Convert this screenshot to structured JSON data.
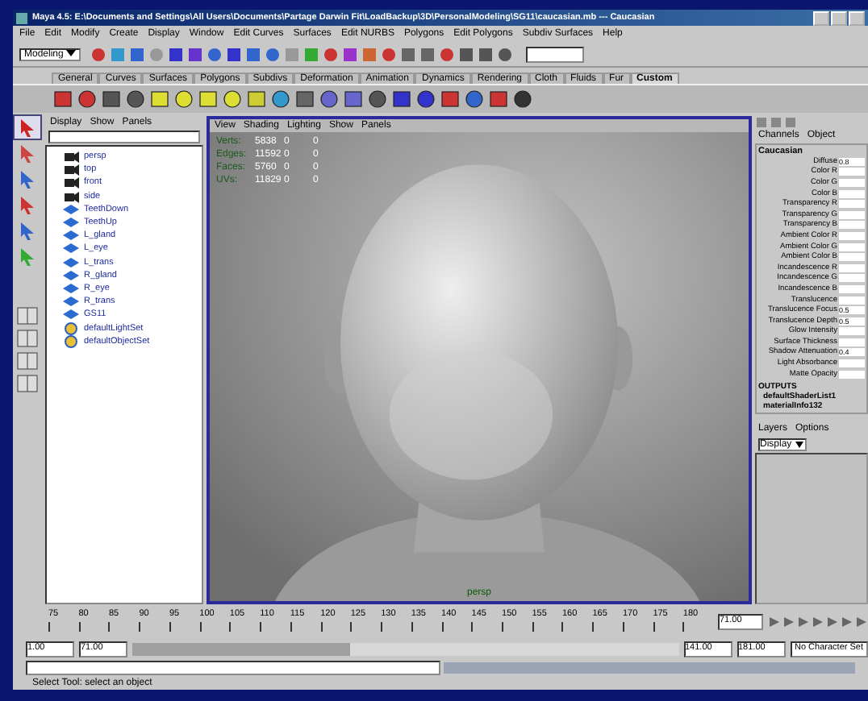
{
  "window": {
    "title": "Maya 4.5: E:\\Documents and Settings\\All Users\\Documents\\Partage Darwin Fit\\LoadBackup\\3D\\PersonalModeling\\SG11\\caucasian.mb  ---  Caucasian"
  },
  "menu": [
    "File",
    "Edit",
    "Modify",
    "Create",
    "Display",
    "Window",
    "Edit Curves",
    "Surfaces",
    "Edit NURBS",
    "Polygons",
    "Edit Polygons",
    "Subdiv Surfaces",
    "Help"
  ],
  "toolbar": {
    "mode": "Modeling"
  },
  "shelf_tabs": [
    {
      "label": "General",
      "selected": false
    },
    {
      "label": "Curves",
      "selected": false
    },
    {
      "label": "Surfaces",
      "selected": false
    },
    {
      "label": "Polygons",
      "selected": false
    },
    {
      "label": "Subdivs",
      "selected": false
    },
    {
      "label": "Deformation",
      "selected": false
    },
    {
      "label": "Animation",
      "selected": false
    },
    {
      "label": "Dynamics",
      "selected": false
    },
    {
      "label": "Rendering",
      "selected": false
    },
    {
      "label": "Cloth",
      "selected": false
    },
    {
      "label": "Fluids",
      "selected": false
    },
    {
      "label": "Fur",
      "selected": false
    },
    {
      "label": "Custom",
      "selected": true
    }
  ],
  "outliner": {
    "menu": [
      "Display",
      "Show",
      "Panels"
    ],
    "items": [
      {
        "name": "persp",
        "kind": "camera"
      },
      {
        "name": "top",
        "kind": "camera"
      },
      {
        "name": "front",
        "kind": "camera"
      },
      {
        "name": "side",
        "kind": "camera"
      },
      {
        "name": "TeethDown",
        "kind": "mesh"
      },
      {
        "name": "TeethUp",
        "kind": "mesh"
      },
      {
        "name": "L_gland",
        "kind": "mesh"
      },
      {
        "name": "L_eye",
        "kind": "mesh"
      },
      {
        "name": "L_trans",
        "kind": "mesh"
      },
      {
        "name": "R_gland",
        "kind": "mesh"
      },
      {
        "name": "R_eye",
        "kind": "mesh"
      },
      {
        "name": "R_trans",
        "kind": "mesh"
      },
      {
        "name": "GS11",
        "kind": "mesh"
      },
      {
        "name": "defaultLightSet",
        "kind": "set"
      },
      {
        "name": "defaultObjectSet",
        "kind": "set"
      }
    ]
  },
  "viewport": {
    "menu": [
      "View",
      "Shading",
      "Lighting",
      "Show",
      "Panels"
    ],
    "hud": [
      {
        "label": "Verts:",
        "values": [
          "5838",
          "0",
          "0"
        ]
      },
      {
        "label": "Edges:",
        "values": [
          "11592",
          "0",
          "0"
        ]
      },
      {
        "label": "Faces:",
        "values": [
          "5760",
          "0",
          "0"
        ]
      },
      {
        "label": "UVs:",
        "values": [
          "11829",
          "0",
          "0"
        ]
      }
    ],
    "camera": "persp"
  },
  "channel_box": {
    "tabs": [
      "Channels",
      "Object"
    ],
    "node": "Caucasian",
    "attributes": [
      {
        "name": "Diffuse",
        "value": "0.8"
      },
      {
        "name": "Color R"
      },
      {
        "name": "Color G"
      },
      {
        "name": "Color B"
      },
      {
        "name": "Transparency R"
      },
      {
        "name": "Transparency G"
      },
      {
        "name": "Transparency B"
      },
      {
        "name": "Ambient Color R"
      },
      {
        "name": "Ambient Color G"
      },
      {
        "name": "Ambient Color B"
      },
      {
        "name": "Incandescence R"
      },
      {
        "name": "Incandescence G"
      },
      {
        "name": "Incandescence B"
      },
      {
        "name": "Translucence"
      },
      {
        "name": "Translucence Focus",
        "value": "0.5"
      },
      {
        "name": "Translucence Depth",
        "value": "0.5"
      },
      {
        "name": "Glow Intensity"
      },
      {
        "name": "Surface Thickness"
      },
      {
        "name": "Shadow Attenuation",
        "value": "0.4"
      },
      {
        "name": "Light Absorbance"
      },
      {
        "name": "Matte Opacity"
      }
    ],
    "outputs_label": "OUTPUTS",
    "outputs": [
      "defaultShaderList1",
      "materialInfo132"
    ],
    "layers_tabs": [
      "Layers",
      "Options"
    ],
    "layers_mode": "Display"
  },
  "timeline": {
    "ticks": [
      "75",
      "80",
      "85",
      "90",
      "95",
      "100",
      "105",
      "110",
      "115",
      "120",
      "125",
      "130",
      "135",
      "140",
      "145",
      "150",
      "155",
      "160",
      "165",
      "170",
      "175",
      "180"
    ],
    "current": "71.00"
  },
  "range": {
    "start": "1.00",
    "range_start": "71.00",
    "range_end": "141.00",
    "end": "181.00",
    "character_set": "No Character Set",
    "level": 0.4
  },
  "help_line": "Select Tool: select an object"
}
